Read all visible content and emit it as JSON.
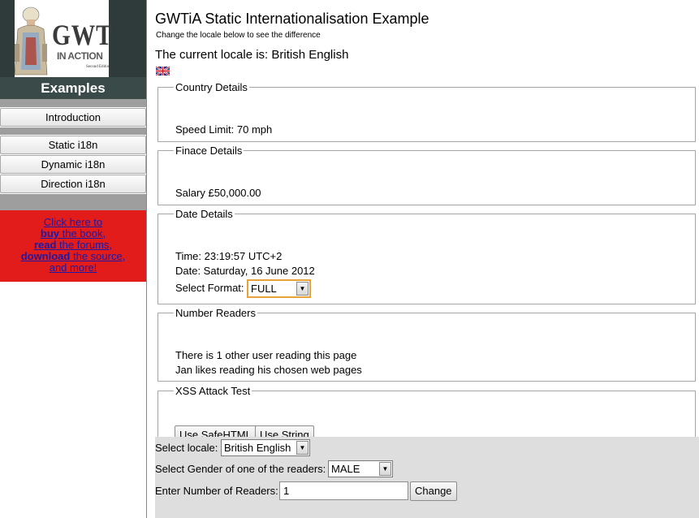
{
  "sidebar": {
    "logo": {
      "title": "GWT",
      "subtitle": "IN ACTION",
      "edition": "Second Edition"
    },
    "header": "Examples",
    "nav": [
      {
        "label": "Introduction"
      },
      {
        "label": "Static i18n"
      },
      {
        "label": "Dynamic i18n"
      },
      {
        "label": "Direction i18n"
      }
    ],
    "promo": {
      "line1": "Click here to",
      "buy": "buy",
      "line2": " the book,",
      "read": "read",
      "line3": " the forums,",
      "download": "download",
      "line4": " the source,",
      "line5": "and more!"
    }
  },
  "main": {
    "title": "GWTiA Static Internationalisation Example",
    "subtitle": "Change the locale below to see the difference",
    "current_locale": "The current locale is: British English",
    "flag_icon": "uk-flag-icon",
    "country": {
      "legend": "Country Details",
      "speed": "Speed Limit: 70 mph"
    },
    "finance": {
      "legend": "Finace Details",
      "salary": "Salary £50,000.00"
    },
    "date": {
      "legend": "Date Details",
      "time": "Time: 23:19:57 UTC+2",
      "date": "Date: Saturday, 16 June 2012",
      "format_label": "Select Format:",
      "format_value": "FULL"
    },
    "readers": {
      "legend": "Number Readers",
      "line1": "There is 1 other user reading this page",
      "line2": "Jan likes reading his chosen web pages"
    },
    "xss": {
      "legend": "XSS Attack Test",
      "safe_button": "Use SafeHTML",
      "string_button": "Use String"
    }
  },
  "controls": {
    "locale_label": "Select locale:",
    "locale_value": "British English",
    "gender_label": "Select Gender of one of the readers:",
    "gender_value": "MALE",
    "readers_label": "Enter Number of Readers:",
    "readers_value": "1",
    "change_button": "Change"
  },
  "colors": {
    "promo_bg": "#e21b1b",
    "header_bg": "#3a4a48",
    "bottom_bg": "#dedede"
  }
}
